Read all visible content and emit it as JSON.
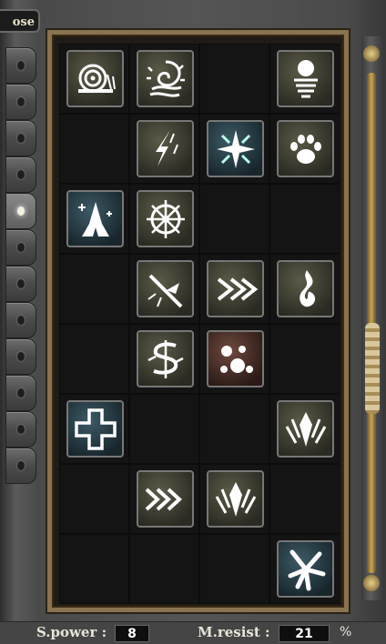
{
  "window": {
    "close_label": "ose"
  },
  "left_rail": {
    "buttons": [
      {
        "icon": "dot-icon",
        "active": false
      },
      {
        "icon": "dot-icon",
        "active": false
      },
      {
        "icon": "dot-icon",
        "active": false
      },
      {
        "icon": "dot-icon",
        "active": false
      },
      {
        "icon": "dot-icon",
        "active": true
      },
      {
        "icon": "dot-icon",
        "active": false
      },
      {
        "icon": "dot-icon",
        "active": false
      },
      {
        "icon": "dot-icon",
        "active": false
      },
      {
        "icon": "dot-icon",
        "active": false
      },
      {
        "icon": "dot-icon",
        "active": false
      },
      {
        "icon": "dot-icon",
        "active": false
      },
      {
        "icon": "dot-icon",
        "active": false
      }
    ]
  },
  "skill_grid": {
    "columns": 4,
    "rows": 8,
    "cells": [
      {
        "icon": "snail-icon",
        "color": "olive"
      },
      {
        "icon": "spiral-storm-icon",
        "color": "olive"
      },
      null,
      {
        "icon": "orb-icon",
        "color": "olive"
      },
      null,
      {
        "icon": "lightning-icon",
        "color": "olive"
      },
      {
        "icon": "star-burst-icon",
        "color": "teal"
      },
      {
        "icon": "paw-icon",
        "color": "olive"
      },
      {
        "icon": "praying-hands-icon",
        "color": "teal"
      },
      {
        "icon": "wheel-icon",
        "color": "olive"
      },
      null,
      null,
      null,
      {
        "icon": "strike-icon",
        "color": "olive"
      },
      {
        "icon": "double-arrow-icon",
        "color": "olive"
      },
      {
        "icon": "flame-icon",
        "color": "olive"
      },
      null,
      {
        "icon": "rune-icon",
        "color": "olive"
      },
      {
        "icon": "spots-icon",
        "color": "brown"
      },
      null,
      {
        "icon": "cross-icon",
        "color": "teal"
      },
      null,
      null,
      {
        "icon": "shield-spikes-icon",
        "color": "olive"
      },
      null,
      {
        "icon": "triple-arrow-icon",
        "color": "olive"
      },
      {
        "icon": "shield-spikes-icon",
        "color": "olive"
      },
      null,
      null,
      null,
      null,
      {
        "icon": "blade-burst-icon",
        "color": "teal"
      }
    ]
  },
  "stats": {
    "spower_label": "S.power :",
    "spower_value": "8",
    "mresist_label": "M.resist :",
    "mresist_value": "21",
    "percent_sign": "%"
  }
}
